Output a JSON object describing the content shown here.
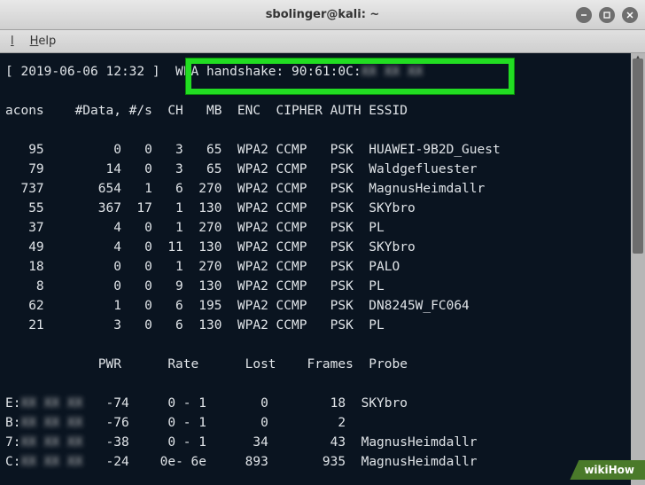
{
  "window": {
    "title": "sbolinger@kali: ~"
  },
  "menu": {
    "item1_prefix": "l",
    "item2_letter": "H",
    "item2_rest": "elp"
  },
  "status_line": {
    "timestamp": "[ 2019-06-06 12:32 ]",
    "handshake_label": "WPA handshake:",
    "handshake_mac_visible": "90:61:0C:",
    "handshake_mac_hidden": "XX XX XX"
  },
  "ap_headers": [
    "acons",
    "#Data,",
    "#/s",
    "CH",
    "MB",
    "ENC",
    "CIPHER",
    "AUTH",
    "ESSID"
  ],
  "ap_rows": [
    {
      "beacons": "95",
      "data": "0",
      "ps": "0",
      "ch": "3",
      "mb": "65",
      "enc": "WPA2",
      "cipher": "CCMP",
      "auth": "PSK",
      "essid": "HUAWEI-9B2D_Guest"
    },
    {
      "beacons": "79",
      "data": "14",
      "ps": "0",
      "ch": "3",
      "mb": "65",
      "enc": "WPA2",
      "cipher": "CCMP",
      "auth": "PSK",
      "essid": "Waldgefluester"
    },
    {
      "beacons": "737",
      "data": "654",
      "ps": "1",
      "ch": "6",
      "mb": "270",
      "enc": "WPA2",
      "cipher": "CCMP",
      "auth": "PSK",
      "essid": "MagnusHeimdallr"
    },
    {
      "beacons": "55",
      "data": "367",
      "ps": "17",
      "ch": "1",
      "mb": "130",
      "enc": "WPA2",
      "cipher": "CCMP",
      "auth": "PSK",
      "essid": "SKYbro"
    },
    {
      "beacons": "37",
      "data": "4",
      "ps": "0",
      "ch": "1",
      "mb": "270",
      "enc": "WPA2",
      "cipher": "CCMP",
      "auth": "PSK",
      "essid": "PL"
    },
    {
      "beacons": "49",
      "data": "4",
      "ps": "0",
      "ch": "11",
      "mb": "130",
      "enc": "WPA2",
      "cipher": "CCMP",
      "auth": "PSK",
      "essid": "SKYbro"
    },
    {
      "beacons": "18",
      "data": "0",
      "ps": "0",
      "ch": "1",
      "mb": "270",
      "enc": "WPA2",
      "cipher": "CCMP",
      "auth": "PSK",
      "essid": "PALO"
    },
    {
      "beacons": "8",
      "data": "0",
      "ps": "0",
      "ch": "9",
      "mb": "130",
      "enc": "WPA2",
      "cipher": "CCMP",
      "auth": "PSK",
      "essid": "PL"
    },
    {
      "beacons": "62",
      "data": "1",
      "ps": "0",
      "ch": "6",
      "mb": "195",
      "enc": "WPA2",
      "cipher": "CCMP",
      "auth": "PSK",
      "essid": "DN8245W_FC064"
    },
    {
      "beacons": "21",
      "data": "3",
      "ps": "0",
      "ch": "6",
      "mb": "130",
      "enc": "WPA2",
      "cipher": "CCMP",
      "auth": "PSK",
      "essid": "PL"
    }
  ],
  "client_headers": [
    "",
    "PWR",
    "Rate",
    "Lost",
    "Frames",
    "Probe"
  ],
  "client_rows": [
    {
      "id": "E:",
      "pwr": "-74",
      "rate": "0 - 1",
      "lost": "0",
      "frames": "18",
      "probe": "SKYbro"
    },
    {
      "id": "B:",
      "pwr": "-76",
      "rate": "0 - 1",
      "lost": "0",
      "frames": "2",
      "probe": ""
    },
    {
      "id": "7:",
      "pwr": "-38",
      "rate": "0 - 1",
      "lost": "34",
      "frames": "43",
      "probe": "MagnusHeimdallr"
    },
    {
      "id": "C:",
      "pwr": "-24",
      "rate": "0e- 6e",
      "lost": "893",
      "frames": "935",
      "probe": "MagnusHeimdallr"
    }
  ],
  "watermark": "wikiHow"
}
